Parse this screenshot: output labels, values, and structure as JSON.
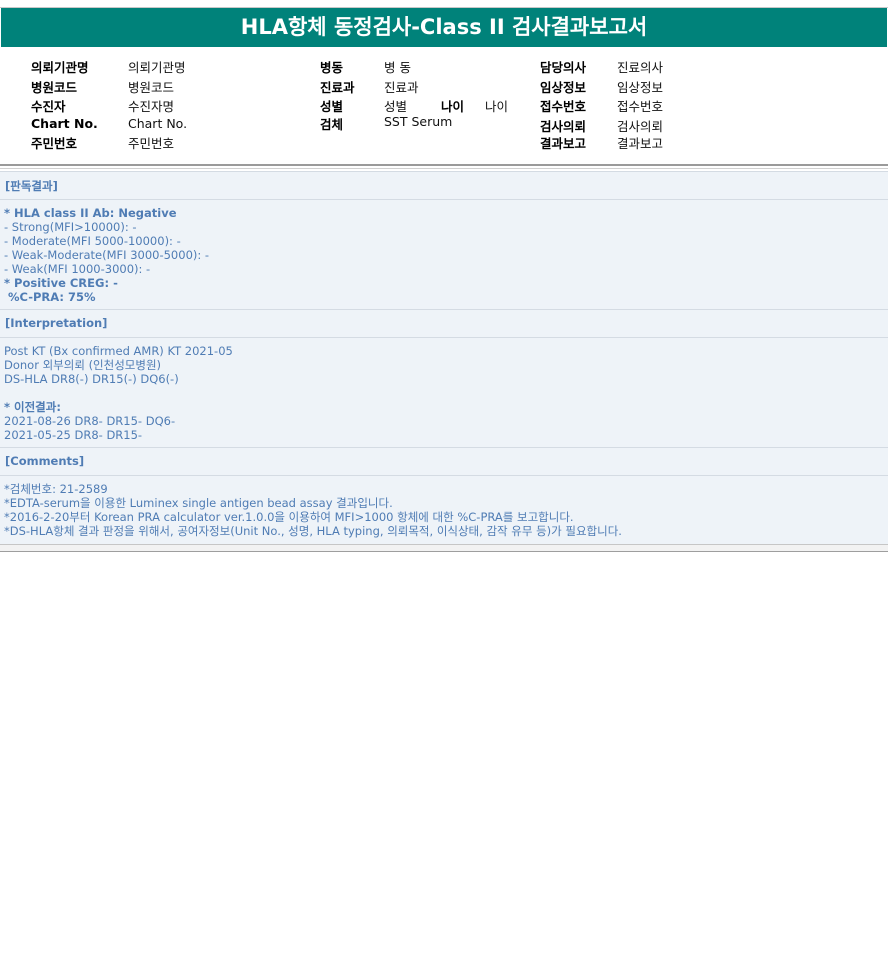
{
  "header": {
    "title": "HLA항체 동정검사-Class II 검사결과보고서"
  },
  "info": {
    "col1": [
      {
        "label": "의뢰기관명",
        "value": "의뢰기관명"
      },
      {
        "label": "병원코드",
        "value": "병원코드"
      },
      {
        "label": "수진자",
        "value": "수진자명"
      },
      {
        "label": "Chart No.",
        "value": "Chart No."
      },
      {
        "label": "주민번호",
        "value": "주민번호"
      }
    ],
    "col2": [
      {
        "label": "병동",
        "value": "병 동"
      },
      {
        "label": "진료과",
        "value": "진료과"
      },
      {
        "label": "성별",
        "value": "성별"
      },
      {
        "label": "검체",
        "value": "SST Serum"
      }
    ],
    "age": {
      "label": "나이",
      "value": "나이"
    },
    "col3": [
      {
        "label": "담당의사",
        "value": "진료의사"
      },
      {
        "label": "임상정보",
        "value": "임상정보"
      },
      {
        "label": "접수번호",
        "value": "접수번호"
      },
      {
        "label": "검사의뢰",
        "value": "검사의뢰"
      },
      {
        "label": "결과보고",
        "value": "결과보고"
      }
    ]
  },
  "sections": {
    "reading": {
      "title": "[판독결과]",
      "lines": [
        "* HLA class II Ab: Negative",
        "- Strong(MFI>10000): -",
        "- Moderate(MFI 5000-10000): -",
        "- Weak-Moderate(MFI 3000-5000): -",
        "- Weak(MFI 1000-3000): -",
        "* Positive CREG: -",
        " %C-PRA: 75%"
      ]
    },
    "interpretation": {
      "title": "[Interpretation]",
      "lines": [
        "Post KT (Bx confirmed AMR) KT 2021-05",
        "Donor 외부의뢰 (인천성모병원)",
        "DS-HLA DR8(-) DR15(-) DQ6(-)",
        "",
        "* 이전결과:",
        "2021-08-26 DR8- DR15- DQ6-",
        "2021-05-25 DR8- DR15-"
      ]
    },
    "comments": {
      "title": "[Comments]",
      "lines": [
        "*검체번호: 21-2589",
        "*EDTA-serum을 이용한 Luminex single antigen bead assay 결과입니다.",
        "*2016-2-20부터 Korean PRA calculator ver.1.0.0을 이용하여 MFI>1000 항체에 대한 %C-PRA를 보고합니다.",
        "*DS-HLA항체 결과 판정을 위해서, 공여자정보(Unit No., 성명, HLA typing, 의뢰목적, 이식상태, 감작 유무 등)가 필요합니다."
      ]
    }
  },
  "colors": {
    "title_bg": "#00827a",
    "report_bg": "#eef3f8",
    "report_text": "#4f7cb4"
  }
}
